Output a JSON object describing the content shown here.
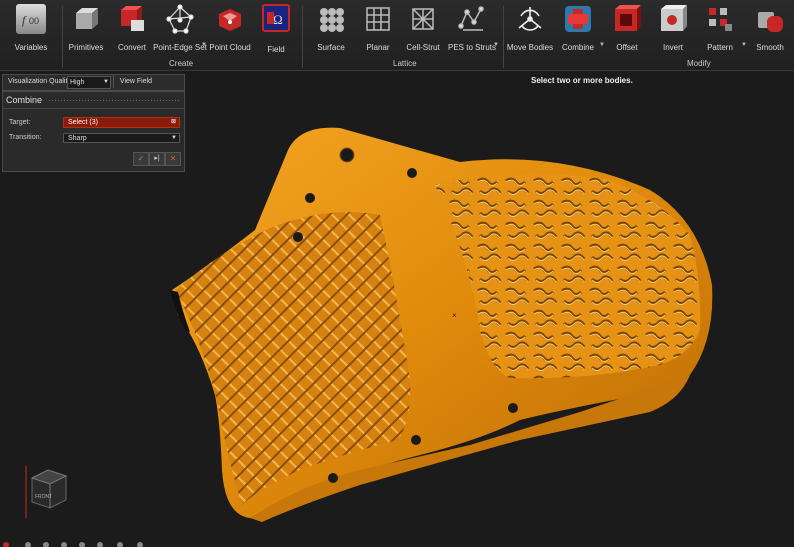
{
  "toolbar": {
    "tools": [
      {
        "label": "Variables",
        "icon": "variables-icon"
      },
      {
        "label": "Primitives",
        "icon": "primitives-icon"
      },
      {
        "label": "Convert",
        "icon": "convert-icon"
      },
      {
        "label": "Point-Edge Set",
        "icon": "point-edge-set-icon"
      },
      {
        "label": "Point Cloud",
        "icon": "point-cloud-icon"
      },
      {
        "label": "Field",
        "icon": "field-icon"
      },
      {
        "label": "Surface",
        "icon": "surface-lattice-icon"
      },
      {
        "label": "Planar",
        "icon": "planar-lattice-icon"
      },
      {
        "label": "Cell-Strut",
        "icon": "cell-strut-icon"
      },
      {
        "label": "PES to Struts",
        "icon": "pes-to-struts-icon"
      },
      {
        "label": "Move Bodies",
        "icon": "move-bodies-icon"
      },
      {
        "label": "Combine",
        "icon": "combine-icon"
      },
      {
        "label": "Offset",
        "icon": "offset-icon"
      },
      {
        "label": "Invert",
        "icon": "invert-icon"
      },
      {
        "label": "Pattern",
        "icon": "pattern-icon"
      },
      {
        "label": "Smooth",
        "icon": "smooth-icon"
      }
    ],
    "groups": {
      "create": "Create",
      "lattice": "Lattice",
      "modify": "Modify"
    }
  },
  "viz": {
    "label": "Visualization Quality",
    "value": "High",
    "view_field": "View Field"
  },
  "combine_panel": {
    "title": "Combine",
    "target_label": "Target:",
    "target_value": "Select (3)",
    "transition_label": "Transition:",
    "transition_value": "Sharp"
  },
  "hint": "Select two or more bodies.",
  "colors": {
    "accent": "#c0392b",
    "part": "#e8900e",
    "background": "#1b1b1b"
  }
}
